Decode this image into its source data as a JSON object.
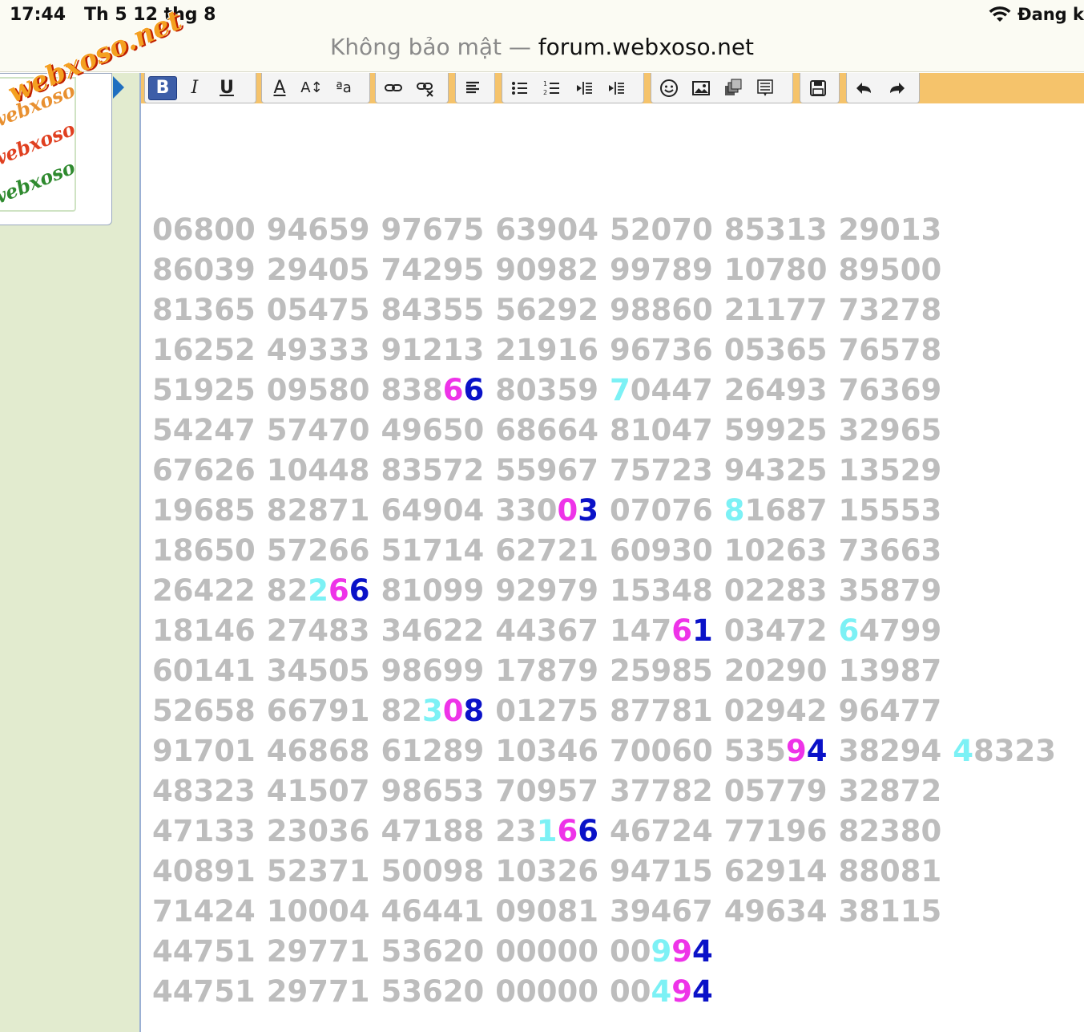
{
  "status_bar": {
    "time": "17:44",
    "date": "Th 5 12 thg 8",
    "network_label": "Đang k"
  },
  "address_bar": {
    "insecure_label": "Không bảo mật —",
    "host": "forum.webxoso.net"
  },
  "logo": {
    "text": "webxoso.net",
    "thumb_text": "webxoso.net"
  },
  "toolbar": {
    "bold": "B",
    "italic": "I",
    "underline": "U",
    "font_color": "A",
    "font_size": "A↕",
    "font_case": "ªa"
  },
  "highlight_colors": {
    "cyan": "#7cf1f5",
    "magenta": "#ee33e8",
    "blue": "#0a12c8",
    "default": "#bdbdbd"
  },
  "rows": [
    [
      {
        "t": "06800"
      },
      {
        "t": "94659"
      },
      {
        "t": "97675"
      },
      {
        "t": "63904"
      },
      {
        "t": "52070"
      },
      {
        "t": "85313"
      },
      {
        "t": "29013"
      }
    ],
    [
      {
        "t": "86039"
      },
      {
        "t": "29405"
      },
      {
        "t": "74295"
      },
      {
        "t": "90982"
      },
      {
        "t": "99789"
      },
      {
        "t": "10780"
      },
      {
        "t": "89500"
      }
    ],
    [
      {
        "t": "81365"
      },
      {
        "t": "05475"
      },
      {
        "t": "84355"
      },
      {
        "t": "56292"
      },
      {
        "t": "98860"
      },
      {
        "t": "21177"
      },
      {
        "t": "73278"
      }
    ],
    [
      {
        "t": "16252"
      },
      {
        "t": "49333"
      },
      {
        "t": "91213"
      },
      {
        "t": "21916"
      },
      {
        "t": "96736"
      },
      {
        "t": "05365"
      },
      {
        "t": "76578"
      }
    ],
    [
      {
        "t": "51925"
      },
      {
        "t": "09580"
      },
      {
        "t": "83866",
        "hl": {
          "3": "magenta",
          "4": "blue"
        }
      },
      {
        "t": "80359"
      },
      {
        "t": "70447",
        "hl": {
          "0": "cyan"
        }
      },
      {
        "t": "26493"
      },
      {
        "t": "76369"
      }
    ],
    [
      {
        "t": "54247"
      },
      {
        "t": "57470"
      },
      {
        "t": "49650"
      },
      {
        "t": "68664"
      },
      {
        "t": "81047"
      },
      {
        "t": "59925"
      },
      {
        "t": "32965"
      }
    ],
    [
      {
        "t": "67626"
      },
      {
        "t": "10448"
      },
      {
        "t": "83572"
      },
      {
        "t": "55967"
      },
      {
        "t": "75723"
      },
      {
        "t": "94325"
      },
      {
        "t": "13529"
      }
    ],
    [
      {
        "t": "19685"
      },
      {
        "t": "82871"
      },
      {
        "t": "64904"
      },
      {
        "t": "33003",
        "hl": {
          "3": "magenta",
          "4": "blue"
        }
      },
      {
        "t": "07076"
      },
      {
        "t": "81687",
        "hl": {
          "0": "cyan"
        }
      },
      {
        "t": "15553"
      }
    ],
    [
      {
        "t": "18650"
      },
      {
        "t": "57266"
      },
      {
        "t": "51714"
      },
      {
        "t": "62721"
      },
      {
        "t": "60930"
      },
      {
        "t": "10263"
      },
      {
        "t": "73663"
      }
    ],
    [
      {
        "t": "26422"
      },
      {
        "t": "82266",
        "hl": {
          "2": "cyan",
          "3": "magenta",
          "4": "blue"
        }
      },
      {
        "t": "81099"
      },
      {
        "t": "92979"
      },
      {
        "t": "15348"
      },
      {
        "t": "02283"
      },
      {
        "t": "35879"
      }
    ],
    [
      {
        "t": "18146"
      },
      {
        "t": "27483"
      },
      {
        "t": "34622"
      },
      {
        "t": "44367"
      },
      {
        "t": "14761",
        "hl": {
          "3": "magenta",
          "4": "blue"
        }
      },
      {
        "t": "03472"
      },
      {
        "t": "64799",
        "hl": {
          "0": "cyan"
        }
      }
    ],
    [
      {
        "t": "60141"
      },
      {
        "t": "34505"
      },
      {
        "t": "98699"
      },
      {
        "t": "17879"
      },
      {
        "t": "25985"
      },
      {
        "t": "20290"
      },
      {
        "t": "13987"
      }
    ],
    [
      {
        "t": "52658"
      },
      {
        "t": "66791"
      },
      {
        "t": "82308",
        "hl": {
          "2": "cyan",
          "3": "magenta",
          "4": "blue"
        }
      },
      {
        "t": "01275"
      },
      {
        "t": "87781"
      },
      {
        "t": "02942"
      },
      {
        "t": "96477"
      }
    ],
    [
      {
        "t": "91701"
      },
      {
        "t": "46868"
      },
      {
        "t": "61289"
      },
      {
        "t": "10346"
      },
      {
        "t": "70060"
      },
      {
        "t": "53594",
        "hl": {
          "3": "magenta",
          "4": "blue"
        }
      },
      {
        "t": "38294"
      },
      {
        "t": "48323",
        "hl": {
          "0": "cyan"
        }
      }
    ],
    [
      {
        "t": "48323"
      },
      {
        "t": "41507"
      },
      {
        "t": "98653"
      },
      {
        "t": "70957"
      },
      {
        "t": "37782"
      },
      {
        "t": "05779"
      },
      {
        "t": "32872"
      }
    ],
    [
      {
        "t": "47133"
      },
      {
        "t": "23036"
      },
      {
        "t": "47188"
      },
      {
        "t": "23166",
        "hl": {
          "2": "cyan",
          "3": "magenta",
          "4": "blue"
        }
      },
      {
        "t": "46724"
      },
      {
        "t": "77196"
      },
      {
        "t": "82380"
      }
    ],
    [
      {
        "t": "40891"
      },
      {
        "t": "52371"
      },
      {
        "t": "50098"
      },
      {
        "t": "10326"
      },
      {
        "t": "94715"
      },
      {
        "t": "62914"
      },
      {
        "t": "88081"
      }
    ],
    [
      {
        "t": "71424"
      },
      {
        "t": "10004"
      },
      {
        "t": "46441"
      },
      {
        "t": "09081"
      },
      {
        "t": "39467"
      },
      {
        "t": "49634"
      },
      {
        "t": "38115"
      }
    ],
    [
      {
        "t": "44751"
      },
      {
        "t": "29771"
      },
      {
        "t": "53620"
      },
      {
        "t": "00000"
      },
      {
        "t": "00994",
        "hl": {
          "2": "cyan",
          "3": "magenta",
          "4": "blue"
        }
      }
    ],
    [
      {
        "t": "44751"
      },
      {
        "t": "29771"
      },
      {
        "t": "53620"
      },
      {
        "t": "00000"
      },
      {
        "t": "00494",
        "hl": {
          "2": "cyan",
          "3": "magenta",
          "4": "blue"
        }
      }
    ]
  ]
}
